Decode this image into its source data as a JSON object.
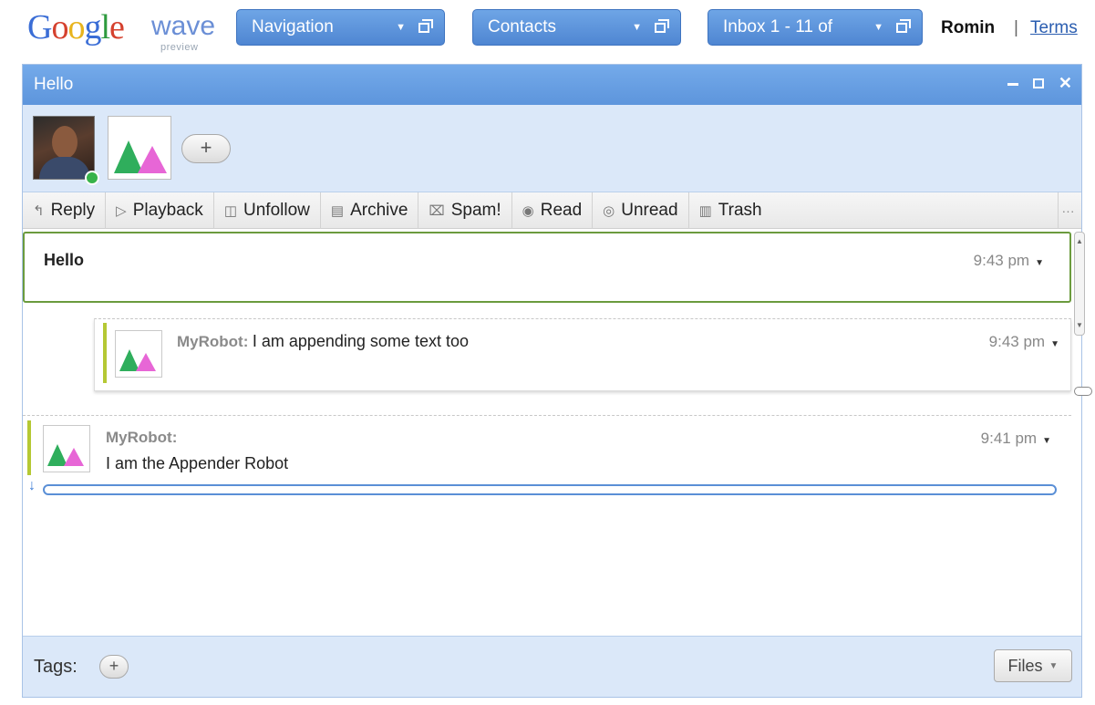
{
  "logo": {
    "brand": "Google",
    "product": "wave",
    "tag": "preview"
  },
  "topbar": {
    "navigation": "Navigation",
    "contacts": "Contacts",
    "inbox": "Inbox 1 - 11 of",
    "user": "Romin",
    "separator": "|",
    "terms": "Terms"
  },
  "wave": {
    "title": "Hello",
    "toolbar": [
      {
        "label": "Reply",
        "icon": "reply-icon",
        "glyph": "↰"
      },
      {
        "label": "Playback",
        "icon": "play-icon",
        "glyph": "▷"
      },
      {
        "label": "Unfollow",
        "icon": "unfollow-icon",
        "glyph": "◫"
      },
      {
        "label": "Archive",
        "icon": "archive-icon",
        "glyph": "▤"
      },
      {
        "label": "Spam!",
        "icon": "spam-icon",
        "glyph": "⌧"
      },
      {
        "label": "Read",
        "icon": "eye-icon",
        "glyph": "◉"
      },
      {
        "label": "Unread",
        "icon": "unread-icon",
        "glyph": "◎"
      },
      {
        "label": "Trash",
        "icon": "trash-icon",
        "glyph": "▥"
      }
    ],
    "more": "···",
    "root_blip": {
      "title": "Hello",
      "time": "9:43 pm"
    },
    "reply_blip": {
      "author": "MyRobot:",
      "text": "I am appending some text too",
      "time": "9:43 pm"
    },
    "second_blip": {
      "author": "MyRobot:",
      "text": "I am the Appender Robot",
      "time": "9:41 pm"
    }
  },
  "footer": {
    "tags_label": "Tags:",
    "add": "+",
    "files": "Files"
  },
  "colors": {
    "accent": "#5d95dc",
    "panel_bg": "#dbe8f9",
    "focus": "#6b9b3e",
    "robot_bar": "#b5c834"
  }
}
